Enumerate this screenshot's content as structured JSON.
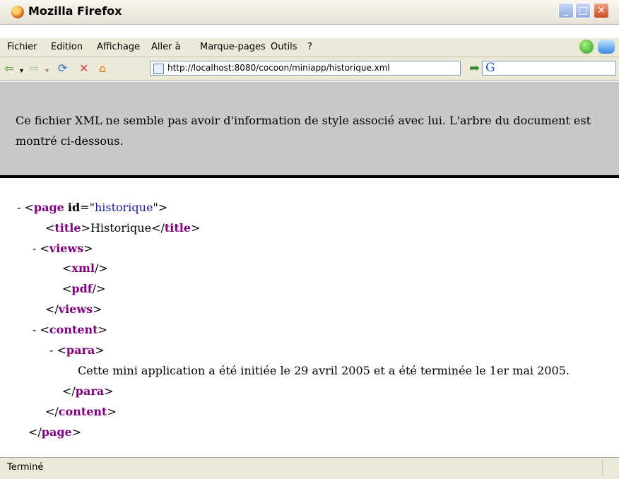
{
  "window": {
    "title": "Mozilla Firefox"
  },
  "menu": {
    "items": [
      "Fichier",
      "Edition",
      "Affichage",
      "Aller à",
      "Marque-pages",
      "Outils",
      "?"
    ]
  },
  "toolbar": {
    "url": "http://localhost:8080/cocoon/miniapp/historique.xml",
    "search_logo": "G"
  },
  "info": {
    "message": "Ce fichier XML ne semble pas avoir d'information de style associé avec lui. L'arbre du document est montré ci-dessous."
  },
  "xml": {
    "root_tag": "page",
    "root_attr_name": "id",
    "root_attr_value": "historique",
    "title_tag": "title",
    "title_text": "Historique",
    "views_tag": "views",
    "xml_tag": "xml",
    "pdf_tag": "pdf",
    "content_tag": "content",
    "para_tag": "para",
    "para_text": "Cette mini application a été initiée le 29 avril 2005 et a été terminée le 1er mai 2005."
  },
  "status": {
    "text": "Terminé"
  },
  "colors": {
    "tag": "#800080",
    "attr_value": "#1a1aa6",
    "info_bg": "#c8c8c8"
  }
}
